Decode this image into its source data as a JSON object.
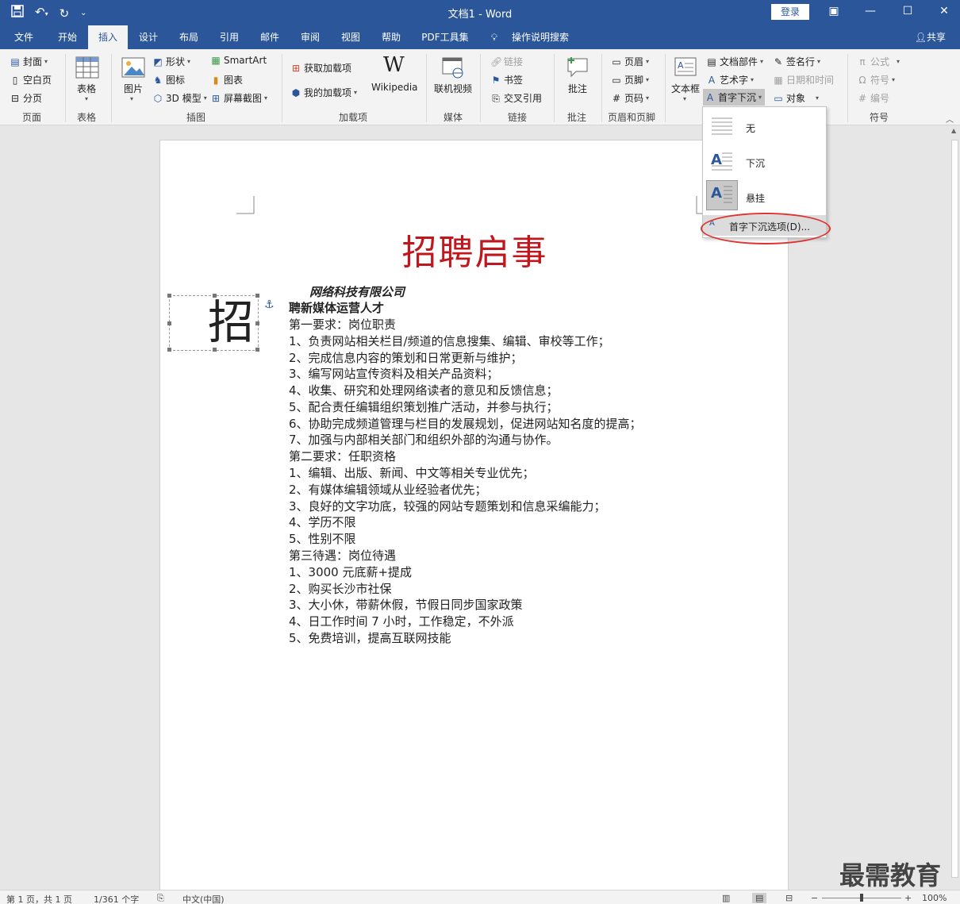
{
  "window": {
    "title": "文档1  -  Word",
    "login_label": "登录",
    "share_label": "共享"
  },
  "tabs": [
    "文件",
    "开始",
    "插入",
    "设计",
    "布局",
    "引用",
    "邮件",
    "审阅",
    "视图",
    "帮助",
    "PDF工具集",
    "操作说明搜索"
  ],
  "active_tab": "插入",
  "ribbon": {
    "page": {
      "label": "页面",
      "cover": "封面",
      "blank": "空白页",
      "break": "分页"
    },
    "table": {
      "label": "表格",
      "table": "表格"
    },
    "illustrations": {
      "label": "插图",
      "picture": "图片",
      "shapes": "形状",
      "icons": "图标",
      "model3d": "3D 模型",
      "smartart": "SmartArt",
      "chart": "图表",
      "screenshot": "屏幕截图"
    },
    "addins": {
      "label": "加载项",
      "get": "获取加载项",
      "my": "我的加载项",
      "wikipedia": "Wikipedia"
    },
    "media": {
      "label": "媒体",
      "video": "联机视频"
    },
    "links": {
      "label": "链接",
      "link": "链接",
      "bookmark": "书签",
      "crossref": "交叉引用"
    },
    "comments": {
      "label": "批注",
      "comment": "批注"
    },
    "headerfooter": {
      "label": "页眉和页脚",
      "header": "页眉",
      "footer": "页脚",
      "pagenum": "页码"
    },
    "text": {
      "textbox": "文本框",
      "quickparts": "文档部件",
      "wordart": "艺术字",
      "dropcap": "首字下沉",
      "signature": "签名行",
      "datetime": "日期和时间",
      "object": "对象"
    },
    "symbols": {
      "label": "符号",
      "equation": "公式",
      "symbol": "符号",
      "number": "编号"
    }
  },
  "dropcap_menu": {
    "none": "无",
    "dropped": "下沉",
    "margin": "悬挂",
    "options": "首字下沉选项(D)..."
  },
  "document": {
    "title": "招聘启事",
    "dropcap_char": "招",
    "company": "网络科技有限公司",
    "headline": "聘新媒体运营人才",
    "lines": [
      "第一要求：岗位职责",
      "1、负责网站相关栏目/频道的信息搜集、编辑、审校等工作；",
      "2、完成信息内容的策划和日常更新与维护；",
      "3、编写网站宣传资料及相关产品资料；",
      "4、收集、研究和处理网络读者的意见和反馈信息；",
      "5、配合责任编辑组织策划推广活动，并参与执行；",
      "6、协助完成频道管理与栏目的发展规划，促进网站知名度的提高；",
      "7、加强与内部相关部门和组织外部的沟通与协作。",
      "第二要求：任职资格",
      "1、编辑、出版、新闻、中文等相关专业优先；",
      "2、有媒体编辑领域从业经验者优先；",
      "3、良好的文字功底，较强的网站专题策划和信息采编能力；",
      "4、学历不限",
      "5、性别不限",
      "第三待遇：岗位待遇",
      "1、3000 元底薪+提成",
      "2、购买长沙市社保",
      "3、大小休，带薪休假，节假日同步国家政策",
      "4、日工作时间 7 小时，工作稳定，不外派",
      "5、免费培训，提高互联网技能"
    ]
  },
  "status": {
    "page": "第 1 页，共 1 页",
    "words": "1/361 个字",
    "lang": "中文(中国)",
    "zoom": "100%"
  },
  "watermark": "最需教育",
  "colors": {
    "brand": "#2b579a",
    "title_red": "#c0161d",
    "highlight": "#e0322f"
  }
}
